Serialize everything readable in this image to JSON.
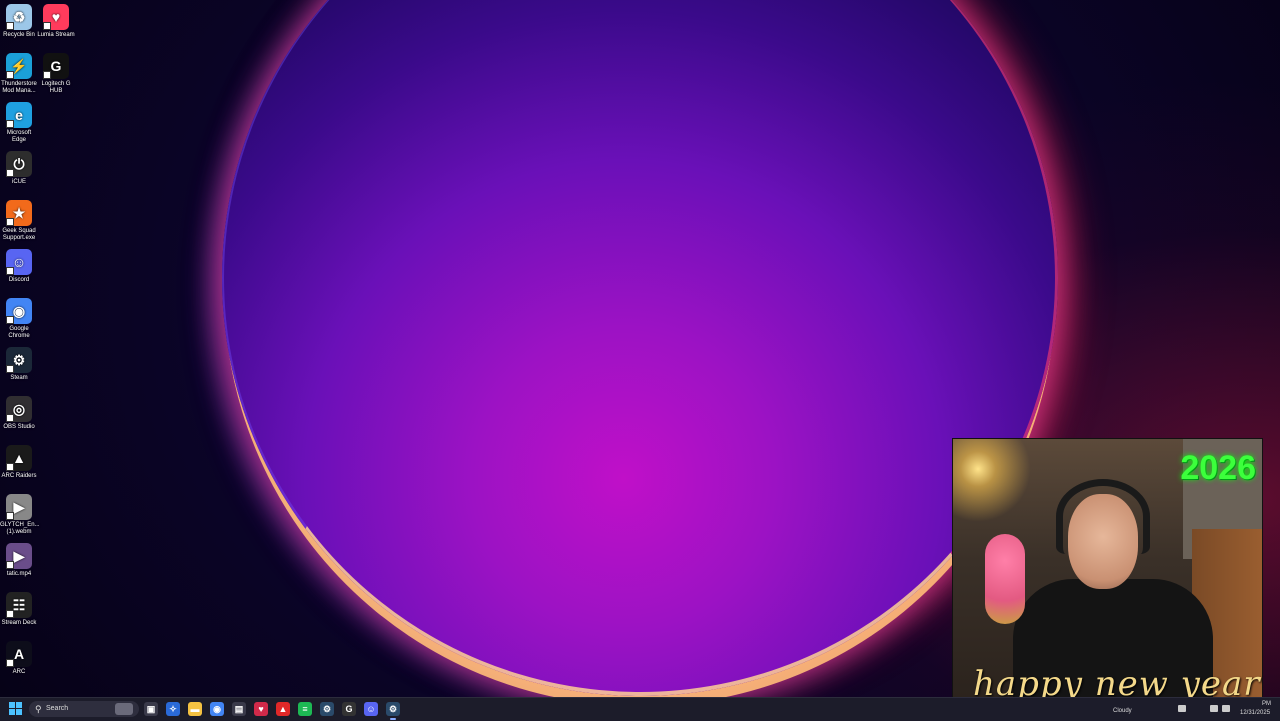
{
  "desktop": {
    "icons": [
      {
        "id": "recycle-bin",
        "label": "Recycle Bin",
        "icon": "recycle-bin-icon",
        "color": "#9cc7e8"
      },
      {
        "id": "lumia-stream",
        "label": "Lumia Stream",
        "icon": "lumia-icon",
        "color": "#ff3b5c"
      },
      {
        "id": "thunderstore",
        "label": "Thunderstore Mod Mana...",
        "icon": "thunderstore-icon",
        "color": "#1ba0d8"
      },
      {
        "id": "logitech-g-hub",
        "label": "Logitech G HUB",
        "icon": "logitech-g-icon",
        "color": "#111111"
      },
      {
        "id": "microsoft-edge",
        "label": "Microsoft Edge",
        "icon": "edge-icon",
        "color": "#1fa0e0"
      },
      {
        "id": "icue",
        "label": "iCUE",
        "icon": "icue-icon",
        "color": "#2d2d2d"
      },
      {
        "id": "geek-squad",
        "label": "Geek Squad Support.exe",
        "icon": "geek-squad-icon",
        "color": "#f26a1b"
      },
      {
        "id": "discord",
        "label": "Discord",
        "icon": "discord-icon",
        "color": "#5865f2"
      },
      {
        "id": "google-chrome",
        "label": "Google Chrome",
        "icon": "chrome-icon",
        "color": "#4285f4"
      },
      {
        "id": "steam",
        "label": "Steam",
        "icon": "steam-icon",
        "color": "#1b2838"
      },
      {
        "id": "obs-studio",
        "label": "OBS Studio",
        "icon": "obs-icon",
        "color": "#302e31"
      },
      {
        "id": "arc-raiders",
        "label": "ARC Raiders",
        "icon": "arc-raiders-icon",
        "color": "#1a1a1a"
      },
      {
        "id": "glytch",
        "label": "GLYTCH_En... (1).webm",
        "icon": "video-file-icon",
        "color": "#888888"
      },
      {
        "id": "static-mp4",
        "label": "tatic.mp4",
        "icon": "video-file-icon",
        "color": "#6a4d8a"
      },
      {
        "id": "stream-deck",
        "label": "Stream Deck",
        "icon": "stream-deck-icon",
        "color": "#222222"
      },
      {
        "id": "arc",
        "label": "ARC",
        "icon": "arc-icon",
        "color": "#0d0d1a"
      }
    ]
  },
  "webcam": {
    "year_text": "2026",
    "greeting_text": "happy new year"
  },
  "taskbar": {
    "search_label": "Search",
    "apps": [
      {
        "name": "task-view",
        "icon": "task-view-icon",
        "color": "#3a3a4a"
      },
      {
        "name": "copilot",
        "icon": "copilot-icon",
        "color": "#2a6ad8"
      },
      {
        "name": "file-explorer",
        "icon": "folder-icon",
        "color": "#f5c242"
      },
      {
        "name": "google-chrome",
        "icon": "chrome-icon",
        "color": "#4285f4"
      },
      {
        "name": "microsoft-store",
        "icon": "store-icon",
        "color": "#3a3a4a"
      },
      {
        "name": "lumia",
        "icon": "lumia-icon",
        "color": "#d12a4a"
      },
      {
        "name": "arc-red",
        "icon": "app-icon",
        "color": "#e02828"
      },
      {
        "name": "spotify",
        "icon": "spotify-icon",
        "color": "#1db954"
      },
      {
        "name": "steam",
        "icon": "steam-icon",
        "color": "#2a4a6a"
      },
      {
        "name": "logitech-g-hub",
        "icon": "logitech-g-icon",
        "color": "#333333"
      },
      {
        "name": "discord",
        "icon": "discord-icon",
        "color": "#5865f2"
      },
      {
        "name": "steam-active",
        "icon": "steam-icon",
        "color": "#2a4a6a"
      }
    ],
    "weather_label": "Cloudy",
    "time": "PM",
    "date": "12/31/2025"
  }
}
